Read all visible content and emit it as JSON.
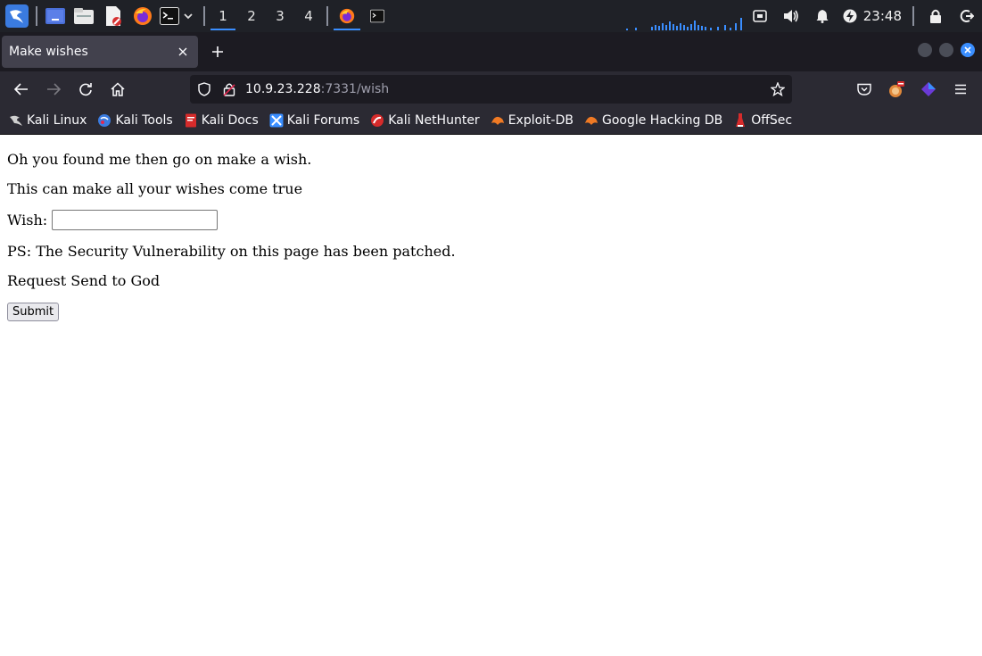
{
  "panel": {
    "workspaces": [
      "1",
      "2",
      "3",
      "4"
    ],
    "active_workspace": "1",
    "clock": "23:48"
  },
  "browser": {
    "tab_title": "Make wishes",
    "url_host": "10.9.23.228",
    "url_path": ":7331/wish"
  },
  "bookmarks": [
    {
      "label": "Kali Linux",
      "icon": "kali-dragon-icon"
    },
    {
      "label": "Kali Tools",
      "icon": "kali-tools-icon"
    },
    {
      "label": "Kali Docs",
      "icon": "kali-docs-icon"
    },
    {
      "label": "Kali Forums",
      "icon": "kali-forums-icon"
    },
    {
      "label": "Kali NetHunter",
      "icon": "kali-nethunter-icon"
    },
    {
      "label": "Exploit-DB",
      "icon": "exploit-db-icon"
    },
    {
      "label": "Google Hacking DB",
      "icon": "ghdb-icon"
    },
    {
      "label": "OffSec",
      "icon": "offsec-icon"
    }
  ],
  "page": {
    "line1": "Oh you found me then go on make a wish.",
    "line2": "This can make all your wishes come true",
    "wish_label": "Wish:",
    "wish_value": "",
    "line3": "PS: The Security Vulnerability on this page has been patched.",
    "line4": "Request Send to God",
    "submit_label": "Submit"
  },
  "colors": {
    "panel_bg": "#1f2127",
    "accent": "#3a8eff",
    "toolbar_bg": "#2b2a33",
    "tab_active": "#42414d"
  }
}
